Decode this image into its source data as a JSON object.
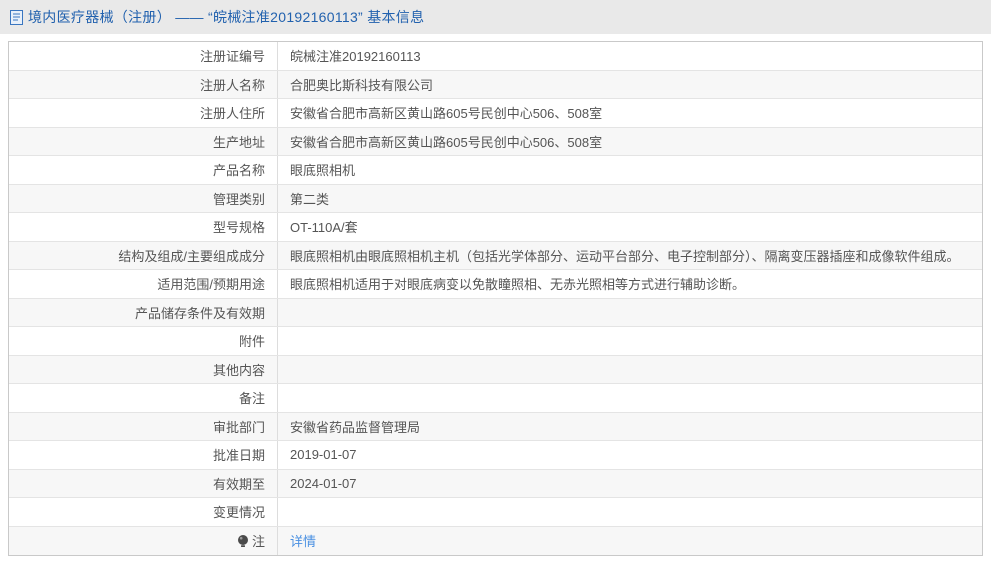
{
  "header": {
    "title": "境内医疗器械（注册） —— “皖械注准20192160113” 基本信息",
    "icon": "document-icon",
    "title_color": "#2161ae",
    "bar_background": "#e9e9e9"
  },
  "table": {
    "stripe_color": "#f7f7f7",
    "border_color": "#c9c9c9",
    "link_color": "#4a90e2",
    "rows": [
      {
        "label": "注册证编号",
        "value": "皖械注准20192160113"
      },
      {
        "label": "注册人名称",
        "value": "合肥奥比斯科技有限公司"
      },
      {
        "label": "注册人住所",
        "value": "安徽省合肥市高新区黄山路605号民创中心506、508室"
      },
      {
        "label": "生产地址",
        "value": "安徽省合肥市高新区黄山路605号民创中心506、508室"
      },
      {
        "label": "产品名称",
        "value": "眼底照相机"
      },
      {
        "label": "管理类别",
        "value": "第二类"
      },
      {
        "label": "型号规格",
        "value": "OT-110A/套"
      },
      {
        "label": "结构及组成/主要组成成分",
        "value": "眼底照相机由眼底照相机主机（包括光学体部分、运动平台部分、电子控制部分）、隔离变压器插座和成像软件组成。"
      },
      {
        "label": "适用范围/预期用途",
        "value": "眼底照相机适用于对眼底病变以免散瞳照相、无赤光照相等方式进行辅助诊断。"
      },
      {
        "label": "产品储存条件及有效期",
        "value": ""
      },
      {
        "label": "附件",
        "value": ""
      },
      {
        "label": "其他内容",
        "value": ""
      },
      {
        "label": "备注",
        "value": ""
      },
      {
        "label": "审批部门",
        "value": "安徽省药品监督管理局"
      },
      {
        "label": "批准日期",
        "value": "2019-01-07"
      },
      {
        "label": "有效期至",
        "value": "2024-01-07"
      },
      {
        "label": "变更情况",
        "value": ""
      },
      {
        "label": "注",
        "value": "详情",
        "icon": "bulb-icon",
        "is_link": true
      }
    ]
  }
}
